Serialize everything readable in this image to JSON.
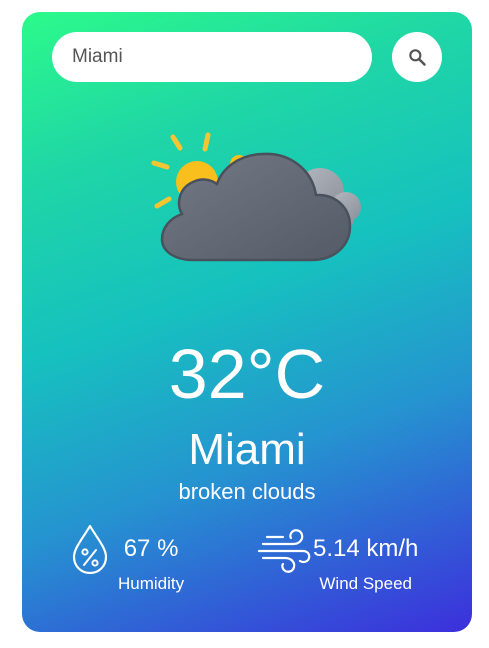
{
  "search": {
    "value": "Miami",
    "button_icon": "search-icon"
  },
  "weather": {
    "icon": "broken-clouds-icon",
    "temperature": "32°C",
    "city": "Miami",
    "description": "broken clouds"
  },
  "humidity": {
    "icon": "humidity-drop-icon",
    "value": "67 %",
    "label": "Humidity"
  },
  "wind": {
    "icon": "wind-icon",
    "value": "5.14 km/h",
    "label": "Wind Speed"
  },
  "colors": {
    "gradient_start": "#2cfa8a",
    "gradient_end": "#3c2fdc",
    "text": "#ffffff"
  }
}
